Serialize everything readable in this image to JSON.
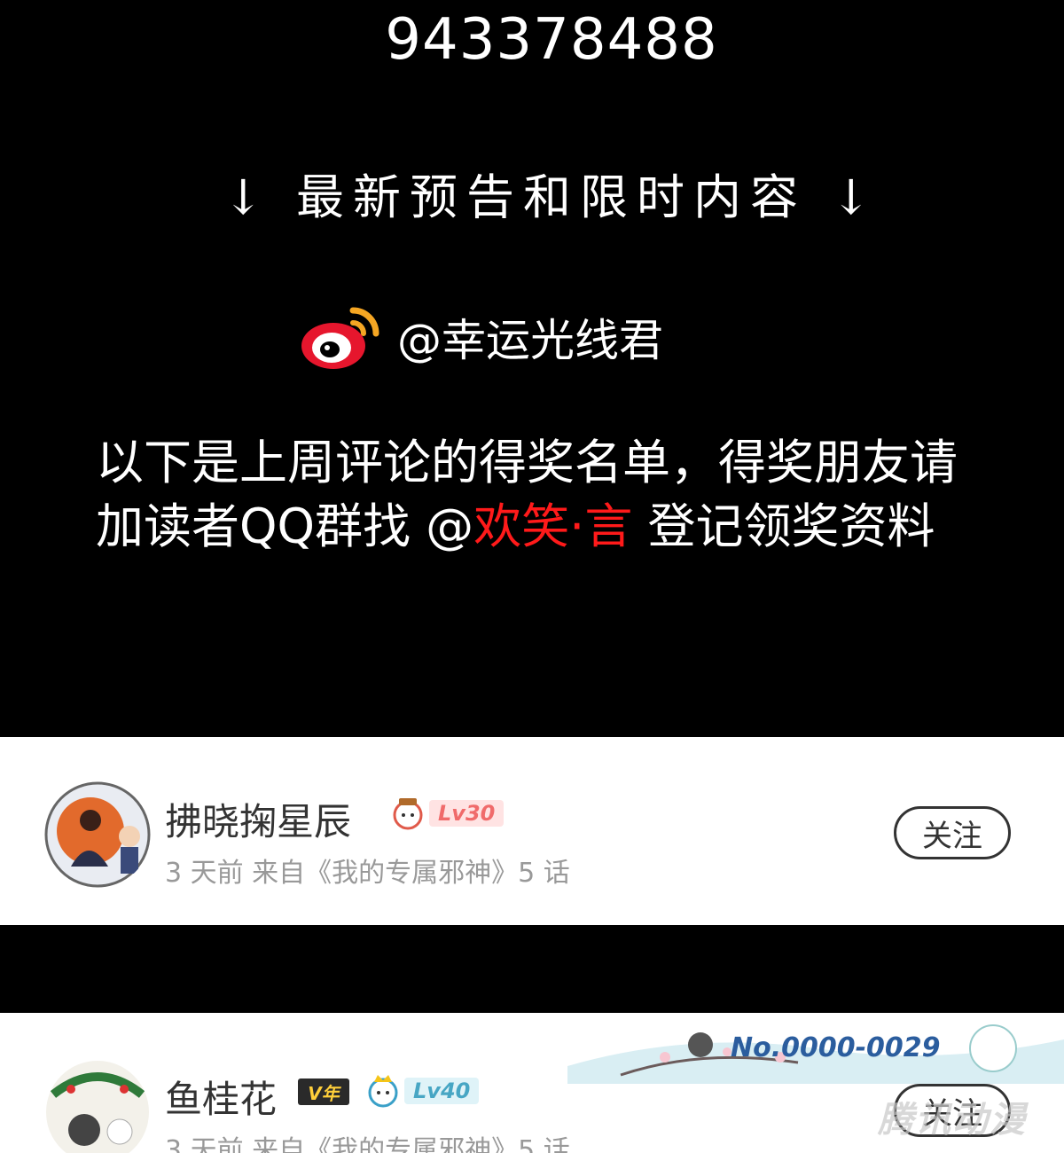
{
  "header": {
    "qq_number": "943378488",
    "preview_line": "↓ 最新预告和限时内容 ↓",
    "weibo_handle": "@幸运光线君"
  },
  "notice": {
    "text_before": "以下是上周评论的得奖名单，得奖朋友请加读者QQ群找 @",
    "highlight": "欢笑·言",
    "text_after": " 登记领奖资料",
    "highlight_color": "#ff1a1a"
  },
  "comments": [
    {
      "username": "拂晓掬星辰",
      "level": "Lv30",
      "meta": "3 天前  来自《我的专属邪神》5 话",
      "follow_label": "关注"
    },
    {
      "username": "鱼桂花",
      "vip": "V年",
      "level": "Lv40",
      "meta": "3 天前  来自《我的专属邪神》5 话",
      "follow_label": "关注",
      "banner_number": "No.0000-0029",
      "watermark": "腾讯动漫"
    }
  ]
}
